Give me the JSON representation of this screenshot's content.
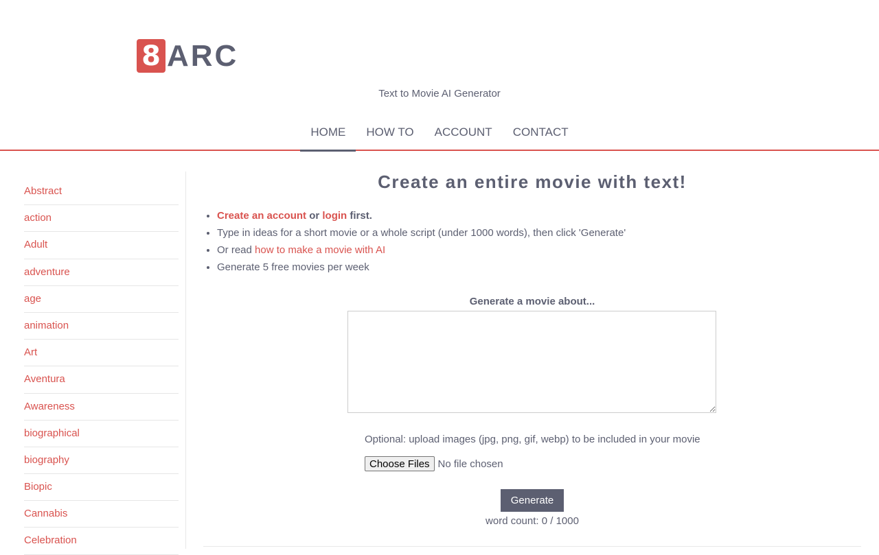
{
  "logo": {
    "mark": "8",
    "text": "ARC"
  },
  "tagline": "Text to Movie AI Generator",
  "nav": [
    {
      "label": "HOME",
      "active": true
    },
    {
      "label": "HOW TO",
      "active": false
    },
    {
      "label": "ACCOUNT",
      "active": false
    },
    {
      "label": "CONTACT",
      "active": false
    }
  ],
  "sidebar": {
    "categories": [
      "Abstract",
      "action",
      "Adult",
      "adventure",
      "age",
      "animation",
      "Art",
      "Aventura",
      "Awareness",
      "biographical",
      "biography",
      "Biopic",
      "Cannabis",
      "Celebration"
    ]
  },
  "main": {
    "heading": "Create an entire movie with text!",
    "intro": {
      "create_account": "Create an account",
      "or": " or ",
      "login": "login",
      "first": " first.",
      "line2": "Type in ideas for a short movie or a whole script (under 1000 words), then click 'Generate'",
      "or_read": "Or read ",
      "howto_link": "how to make a movie with AI",
      "line4": "Generate 5 free movies per week"
    },
    "prompt_label": "Generate a movie about...",
    "prompt_value": "",
    "upload_label": "Optional: upload images (jpg, png, gif, webp) to be included in your movie",
    "choose_files": "Choose Files",
    "no_file": "No file chosen",
    "generate": "Generate",
    "word_count": "word count: 0 / 1000"
  },
  "colors": {
    "accent": "#d9534f",
    "text": "#5c5f71"
  }
}
